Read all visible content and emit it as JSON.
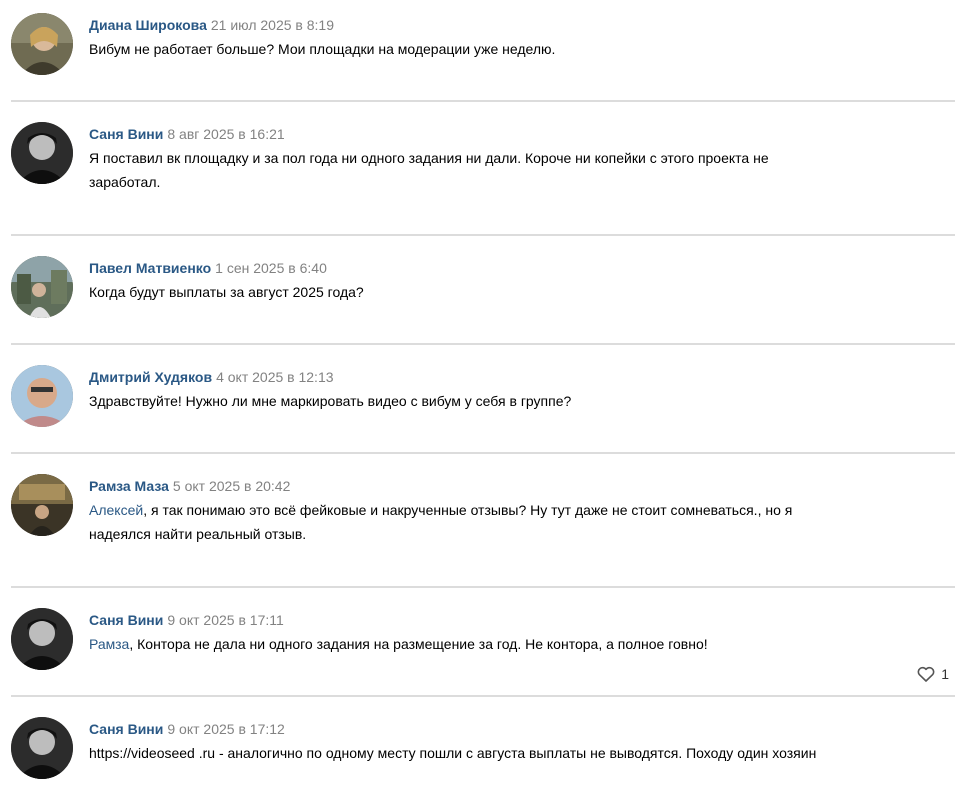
{
  "comments": [
    {
      "author": "Диана Широкова",
      "date": "21 июл 2025 в 8:19",
      "text_lines": [
        "Вибум не работает больше? Мои площадки на модерации уже неделю."
      ]
    },
    {
      "author": "Саня Вини",
      "date": "8 авг 2025 в 16:21",
      "text_lines": [
        "Я поставил вк площадку и за пол года ни одного задания ни дали. Короче ни копейки с этого проекта не",
        "заработал."
      ]
    },
    {
      "author": "Павел Матвиенко",
      "date": "1 сен 2025 в 6:40",
      "text_lines": [
        "Когда будут выплаты за август 2025 года?"
      ]
    },
    {
      "author": "Дмитрий Худяков",
      "date": "4 окт 2025 в 12:13",
      "text_lines": [
        "Здравствуйте! Нужно ли мне маркировать видео с вибум у себя в группе?"
      ]
    },
    {
      "author": "Рамза Маза",
      "date": "5 окт 2025 в 20:42",
      "mention": "Алексей",
      "text_lines": [
        ", я так понимаю это всё фейковые и накрученные отзывы? Ну тут даже не стоит сомневаться., но я",
        "надеялся найти реальный отзыв."
      ]
    },
    {
      "author": "Саня Вини",
      "date": "9 окт 2025 в 17:11",
      "mention": "Рамза",
      "text_lines": [
        ", Контора не дала ни одного задания на размещение за год. Не контора, а полное говно!"
      ],
      "likes": "1"
    },
    {
      "author": "Саня Вини",
      "date": "9 окт 2025 в 17:12",
      "text_lines": [
        "https://videoseed .ru - аналогично по одному месту пошли с августа выплаты не выводятся. Походу один хозяин"
      ]
    }
  ],
  "colors": {
    "author": "#2a5885",
    "date": "#828282",
    "divider": "#dcdcdc",
    "text": "#000000"
  },
  "icons": {
    "like": "heart-icon"
  }
}
